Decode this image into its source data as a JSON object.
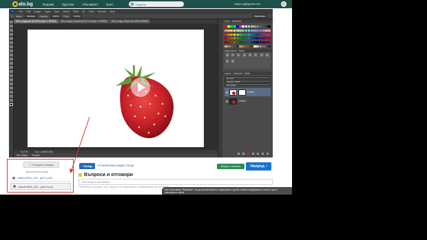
{
  "site": {
    "logo": "alo.bg",
    "nav": [
      "Форуми",
      "Курсове",
      "Абонамент",
      "Блог"
    ],
    "search_value": "Търсене",
    "user_email": "ivaylo.bg@gmail.com"
  },
  "photoshop": {
    "logo": "Ps",
    "menu": [
      "File",
      "Edit",
      "Image",
      "Layer",
      "Type",
      "Select",
      "Filter",
      "3D",
      "View",
      "Window",
      "Help"
    ],
    "options": [
      "Mode:",
      "Normal",
      "Opacity:",
      "100%",
      "Flow:",
      "100%"
    ],
    "workspace": "Essentials",
    "tabs": [
      "M04_ягода.psd @ 50% (Layer 1, RGB/8)",
      "M04_ягода_02.psd @ 66,7% (Layer 1, RGB/8)",
      "M04_ягода_03.psd @ 100% (RGB/8)"
    ],
    "status_zoom": "50,07%",
    "status_doc": "Doc: 1,08M/4,39M",
    "mini_tabs": [
      "Mini Bridge",
      "Timeline"
    ],
    "panel_tabs": [
      "Color",
      "Swatches"
    ],
    "adjust_tabs": [
      "Adjustments",
      "Styles"
    ],
    "layers_tabs": [
      "Layers",
      "Channels",
      "Paths"
    ],
    "layer_kind": "Normal",
    "layer_opacity": "Opacity: 100%",
    "layer_fill": "Fill: 100%",
    "layers": [
      {
        "name": "Слой 1",
        "selected": true
      },
      {
        "name": "Слой 0",
        "selected": false
      }
    ]
  },
  "related": {
    "prev_button": "Предишно видео",
    "label": "Допълнителни уроци",
    "items": [
      {
        "label": "Сваля M04_124 - part 1.psd",
        "active": false
      },
      {
        "label": "Сваля M04_124 - part 2.psd",
        "active": true
      }
    ]
  },
  "buttons": {
    "back": "Назад",
    "alt_link": "Алтернативен видео плеър",
    "cart": "Купи с картата",
    "next": "Напред"
  },
  "qa": {
    "title": "Въпроси и отговори",
    "input_placeholder": "Нов въпрос (заглавие)",
    "desc": "Подробно описание, вкл. версия на софтуера и информация за проблема."
  },
  "cookie": {
    "text": "Ние използваме \"бисквитки\", за да улесним Вашето съдържание и да Ви снижим съдържанието, както и да ги анализирате сайта."
  },
  "colors": {
    "site_bar": "#1f4f4b",
    "next_button": "#1a73d0",
    "annotation": "#d43a33",
    "strawberry": "#c0252a"
  },
  "swatch_colors": [
    "#ff0000",
    "#ffff00",
    "#00ff00",
    "#00ffff",
    "#0000ff",
    "#ff00ff",
    "#ffffff",
    "#e6e6e6",
    "#cccccc",
    "#b3b3b3",
    "#999999",
    "#808080",
    "#666666",
    "#4d4d4d",
    "#333333",
    "#000000",
    "#f7977a",
    "#f9ad81",
    "#fdc68a",
    "#fff79a",
    "#c4df9b",
    "#a2d39c",
    "#82ca9d",
    "#7bcdc8",
    "#6ecff6",
    "#7ea7d8",
    "#8493ca",
    "#8882be",
    "#a187be",
    "#bc8dbf",
    "#f49ac2",
    "#f6989d",
    "#ed1c24",
    "#f26522",
    "#f7941d",
    "#fff200",
    "#8dc73f",
    "#39b54a",
    "#00a651",
    "#00a99d",
    "#00aeef",
    "#0072bc",
    "#0054a6",
    "#2e3192",
    "#662d91",
    "#92278f",
    "#ec008c",
    "#ed145b",
    "#9e0b0f",
    "#a0410d",
    "#a3620a",
    "#aba000",
    "#598527",
    "#1a7b30",
    "#007236",
    "#00746b",
    "#0076a3",
    "#004b80",
    "#003471",
    "#1b1464",
    "#440e62",
    "#630460",
    "#9e005d",
    "#9e0039",
    "#790000",
    "#7b2e00",
    "#7d4900",
    "#827b00",
    "#406618",
    "#005e20",
    "#005826",
    "#005952",
    "#005b7f",
    "#003663",
    "#002157",
    "#0d004c",
    "#32004b",
    "#4b0049",
    "#7b0046",
    "#7a0026",
    "#c7b299",
    "#998675",
    "#736357",
    "#534741",
    "#37302d",
    "#c69c6d",
    "#a67c52",
    "#8c6239",
    "#754c24",
    "#603913",
    "#ffffff",
    "#d2d2d2",
    "#a0a0a0",
    "#787878",
    "#505050",
    "#282828"
  ]
}
